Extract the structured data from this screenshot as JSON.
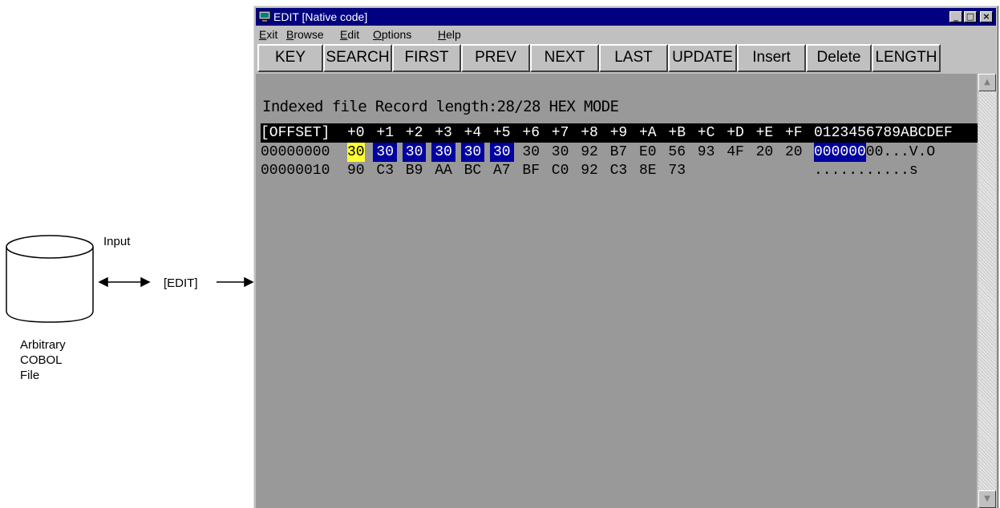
{
  "diagram": {
    "input_label": "Input",
    "edit_label": "[EDIT]",
    "file_caption": [
      "Arbitrary",
      "COBOL",
      "File"
    ]
  },
  "window": {
    "title": "EDIT [Native code]",
    "controls": {
      "minimize": "_",
      "maximize": "□",
      "close": "×"
    },
    "menu": [
      {
        "label": "Exit",
        "mnemonic": "E"
      },
      {
        "label": "Browse",
        "mnemonic": "B"
      },
      {
        "label": "Edit",
        "mnemonic": "E"
      },
      {
        "label": "Options",
        "mnemonic": "O"
      },
      {
        "label": "Help",
        "mnemonic": "H"
      }
    ],
    "toolbar": [
      "KEY",
      "SEARCH",
      "FIRST",
      "PREV",
      "NEXT",
      "LAST",
      "UPDATE",
      "Insert",
      "Delete",
      "LENGTH"
    ],
    "status": "Indexed file  Record length:28/28 HEX MODE",
    "hex": {
      "header_offset": "[OFFSET]",
      "header_cols": [
        "+0",
        "+1",
        "+2",
        "+3",
        "+4",
        "+5",
        "+6",
        "+7",
        "+8",
        "+9",
        "+A",
        "+B",
        "+C",
        "+D",
        "+E",
        "+F"
      ],
      "header_ascii": "0123456789ABCDEF",
      "rows": [
        {
          "offset": "00000000",
          "bytes": [
            "30",
            "30",
            "30",
            "30",
            "30",
            "30",
            "30",
            "30",
            "92",
            "B7",
            "E0",
            "56",
            "93",
            "4F",
            "20",
            "20"
          ],
          "ascii_selected": "000000",
          "ascii_rest": "00...V.O"
        },
        {
          "offset": "00000010",
          "bytes": [
            "90",
            "C3",
            "B9",
            "AA",
            "BC",
            "A7",
            "BF",
            "C0",
            "92",
            "C3",
            "8E",
            "73"
          ],
          "ascii_selected": "",
          "ascii_rest": "...........s"
        }
      ]
    },
    "scrollbar": {
      "up": "▲",
      "down": "▼"
    },
    "colors": {
      "titlebar": "#000080",
      "client_bg": "#999999",
      "cursor": "#ffff33",
      "selection": "#0000a0"
    }
  }
}
